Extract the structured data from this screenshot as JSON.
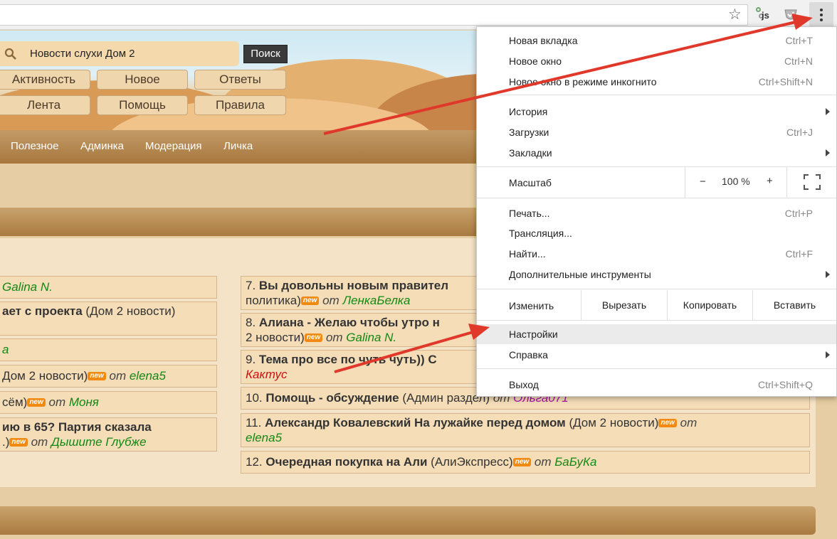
{
  "site": {
    "search_value": "Новости слухи Дом 2",
    "search_button": "Поиск",
    "nav_row1": [
      "Активность",
      "Новое",
      "Ответы"
    ],
    "nav_row2": [
      "Лента",
      "Помощь",
      "Правила"
    ],
    "menubar": [
      "Полезное",
      "Админка",
      "Модерация",
      "Личка"
    ]
  },
  "topics_left": [
    {
      "pre": "",
      "author": "Galina N."
    },
    {
      "bold": "ает с проекта",
      "cat": " (Дом 2 новости)"
    },
    {
      "author": "а"
    },
    {
      "pre": "Дом 2 новости)",
      "ot": " от ",
      "author": "elena5"
    },
    {
      "pre": "сём)",
      "ot": " от ",
      "author": "Моня"
    },
    {
      "bold": "ию в 65? Партия сказала",
      "pre": ".)",
      "ot": " от ",
      "author": "Дышите Глубже"
    }
  ],
  "topics_right": [
    {
      "num": "7. ",
      "bold": "Вы довольны новым правител",
      "pre": "политика)",
      "ot": " от ",
      "author": "ЛенкаБелка"
    },
    {
      "num": "8. ",
      "bold": "Алиана - Желаю чтобы утро н",
      "pre": "2 новости)",
      "ot": " от ",
      "author": "Galina N."
    },
    {
      "num": "9. ",
      "bold": "Тема про все по чуть чуть)) С",
      "author": "Кактус"
    },
    {
      "num": "10. ",
      "bold": "Помощь - обсуждение",
      "cat": " (Админ раздел)",
      "ot": " от ",
      "author": "Ольга071"
    },
    {
      "num": "11. ",
      "bold": "Александр Ковалевский На лужайке перед домом",
      "cat": " (Дом 2 новости)",
      "ot": " от",
      "author": "elena5"
    },
    {
      "num": "12. ",
      "bold": "Очередная покупка на Али",
      "cat": " (АлиЭкспресс)",
      "ot": " от ",
      "author": "БаБуКа"
    }
  ],
  "badge": "new",
  "menu": {
    "new_tab": "Новая вкладка",
    "new_tab_sc": "Ctrl+T",
    "new_window": "Новое окно",
    "new_window_sc": "Ctrl+N",
    "incognito": "Новое окно в режиме инкогнито",
    "incognito_sc": "Ctrl+Shift+N",
    "history": "История",
    "downloads": "Загрузки",
    "downloads_sc": "Ctrl+J",
    "bookmarks": "Закладки",
    "zoom": "Масштаб",
    "zoom_minus": "−",
    "zoom_value": "100 %",
    "zoom_plus": "+",
    "print": "Печать...",
    "print_sc": "Ctrl+P",
    "cast": "Трансляция...",
    "find": "Найти...",
    "find_sc": "Ctrl+F",
    "more_tools": "Дополнительные инструменты",
    "edit": "Изменить",
    "cut": "Вырезать",
    "copy": "Копировать",
    "paste": "Вставить",
    "settings": "Настройки",
    "help": "Справка",
    "exit": "Выход",
    "exit_sc": "Ctrl+Shift+Q"
  },
  "colors": {
    "arrow": "#e0392b",
    "author_green": "#138813",
    "badge": "#f08a10"
  }
}
